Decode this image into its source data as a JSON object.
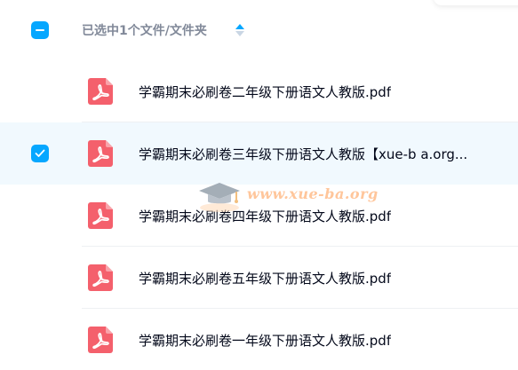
{
  "header": {
    "selection_label": "已选中1个文件/文件夹",
    "sort_icon": "sort-updown-icon"
  },
  "files": [
    {
      "name": "学霸期末必刷卷二年级下册语文人教版.pdf",
      "selected": false
    },
    {
      "name": "学霸期末必刷卷三年级下册语文人教版【xue-b a.org...",
      "selected": true
    },
    {
      "name": "学霸期末必刷卷四年级下册语文人教版.pdf",
      "selected": false
    },
    {
      "name": "学霸期末必刷卷五年级下册语文人教版.pdf",
      "selected": false
    },
    {
      "name": "学霸期末必刷卷一年级下册语文人教版.pdf",
      "selected": false
    }
  ],
  "watermark": {
    "text": "www.xue-ba.org"
  },
  "colors": {
    "accent": "#06a7ff",
    "pdf_red": "#f4606c",
    "selected_row": "#f1f9fe",
    "text_primary": "#03081a",
    "text_secondary": "#818999"
  }
}
